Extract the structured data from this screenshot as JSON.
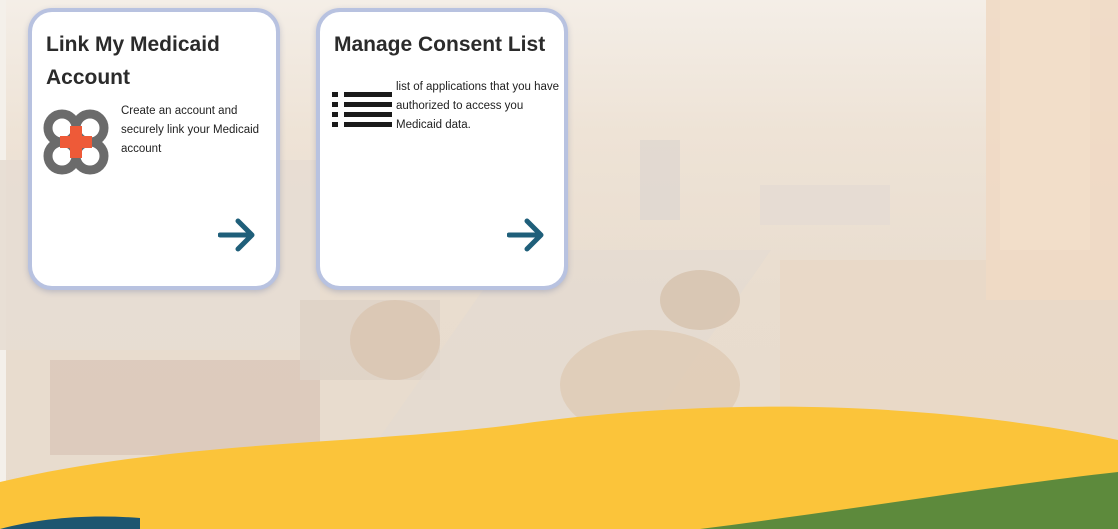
{
  "cards": [
    {
      "title": "Link My Medicaid Account",
      "description": "Create an account and securely link your Medicaid account",
      "icon": "medicaid-link-icon",
      "action_icon": "arrow-right-icon"
    },
    {
      "title": "Manage Consent List",
      "description": "list of applications that you have authorized to access you Medicaid data.",
      "icon": "list-icon",
      "action_icon": "arrow-right-icon"
    }
  ],
  "colors": {
    "card_border": "#b8c2e0",
    "arrow": "#1f5f7a",
    "wave_yellow": "#fbc43a",
    "wave_green": "#5d8a3c",
    "wave_navy": "#1d5670",
    "plus_red": "#ee5a38",
    "ring_gray": "#6b6b6b"
  }
}
